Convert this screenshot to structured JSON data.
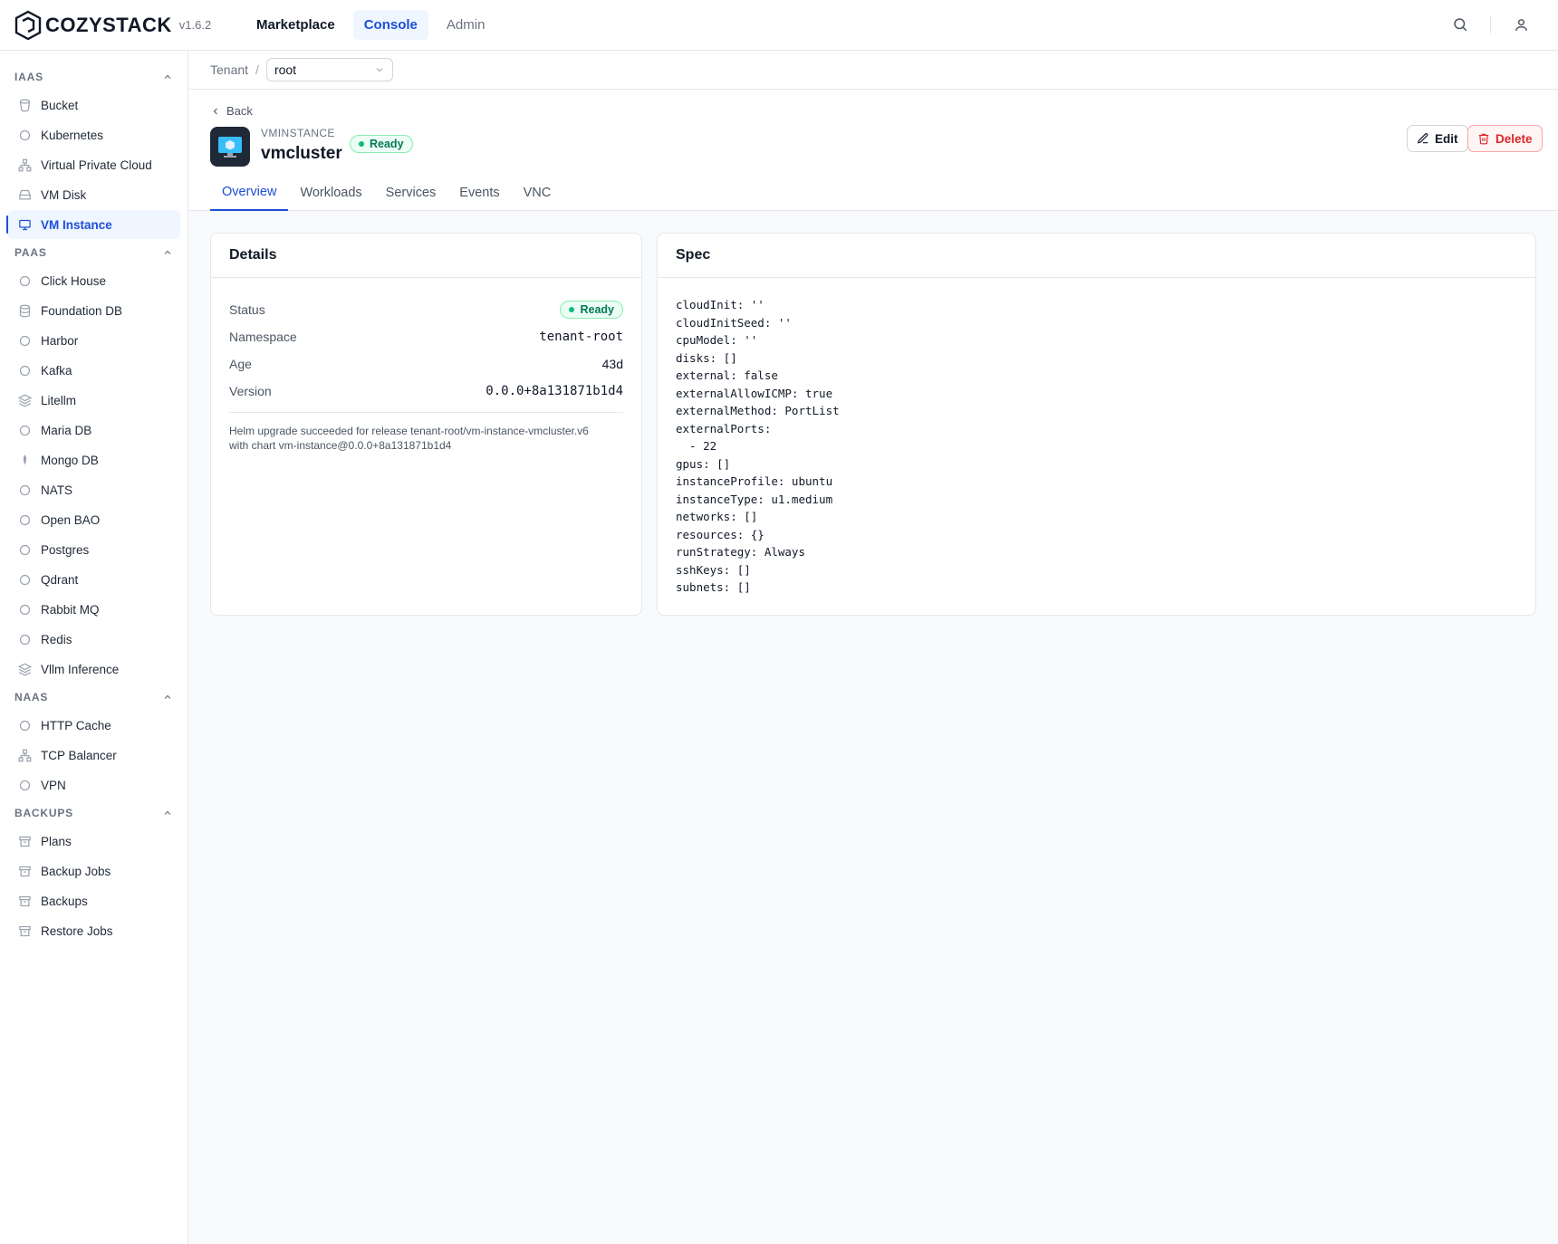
{
  "header": {
    "brand": "COZYSTACK",
    "version": "v1.6.2",
    "nav": [
      {
        "label": "Marketplace"
      },
      {
        "label": "Console"
      },
      {
        "label": "Admin"
      }
    ],
    "icons": [
      "search-icon",
      "user-icon"
    ]
  },
  "sidebar": {
    "sections": [
      {
        "title": "IAAS",
        "items": [
          "Bucket",
          "Kubernetes",
          "Virtual Private Cloud",
          "VM Disk",
          "VM Instance"
        ]
      },
      {
        "title": "PAAS",
        "items": [
          "Click House",
          "Foundation DB",
          "Harbor",
          "Kafka",
          "Litellm",
          "Maria DB",
          "Mongo DB",
          "NATS",
          "Open BAO",
          "Postgres",
          "Qdrant",
          "Rabbit MQ",
          "Redis",
          "Vllm Inference"
        ]
      },
      {
        "title": "NAAS",
        "items": [
          "HTTP Cache",
          "TCP Balancer",
          "VPN"
        ]
      },
      {
        "title": "BACKUPS",
        "items": [
          "Plans",
          "Backup Jobs",
          "Backups",
          "Restore Jobs"
        ]
      }
    ],
    "active_item": "VM Instance"
  },
  "breadcrumb": {
    "tenant_label": "Tenant",
    "separator": "/",
    "selected": "root"
  },
  "resource": {
    "back_label": "Back",
    "kind": "VMINSTANCE",
    "name": "vmcluster",
    "status": "Ready",
    "edit_label": "Edit",
    "delete_label": "Delete",
    "tabs": [
      "Overview",
      "Workloads",
      "Services",
      "Events",
      "VNC"
    ],
    "active_tab": "Overview"
  },
  "details": {
    "title": "Details",
    "status_label": "Status",
    "status_value": "Ready",
    "namespace_label": "Namespace",
    "namespace_value": "tenant-root",
    "age_label": "Age",
    "age_value": "43d",
    "version_label": "Version",
    "version_value": "0.0.0+8a131871b1d4",
    "message_line1": "Helm upgrade succeeded for release tenant-root/vm-instance-vmcluster.v6",
    "message_line2": "with chart vm-instance@0.0.0+8a131871b1d4"
  },
  "spec": {
    "title": "Spec",
    "yaml": "cloudInit: ''\ncloudInitSeed: ''\ncpuModel: ''\ndisks: []\nexternal: false\nexternalAllowICMP: true\nexternalMethod: PortList\nexternalPorts:\n  - 22\ngpus: []\ninstanceProfile: ubuntu\ninstanceType: u1.medium\nnetworks: []\nresources: {}\nrunStrategy: Always\nsshKeys: []\nsubnets: []"
  },
  "colors": {
    "accent": "#1d4ed8",
    "ready": "#047857",
    "danger": "#dc2626"
  }
}
